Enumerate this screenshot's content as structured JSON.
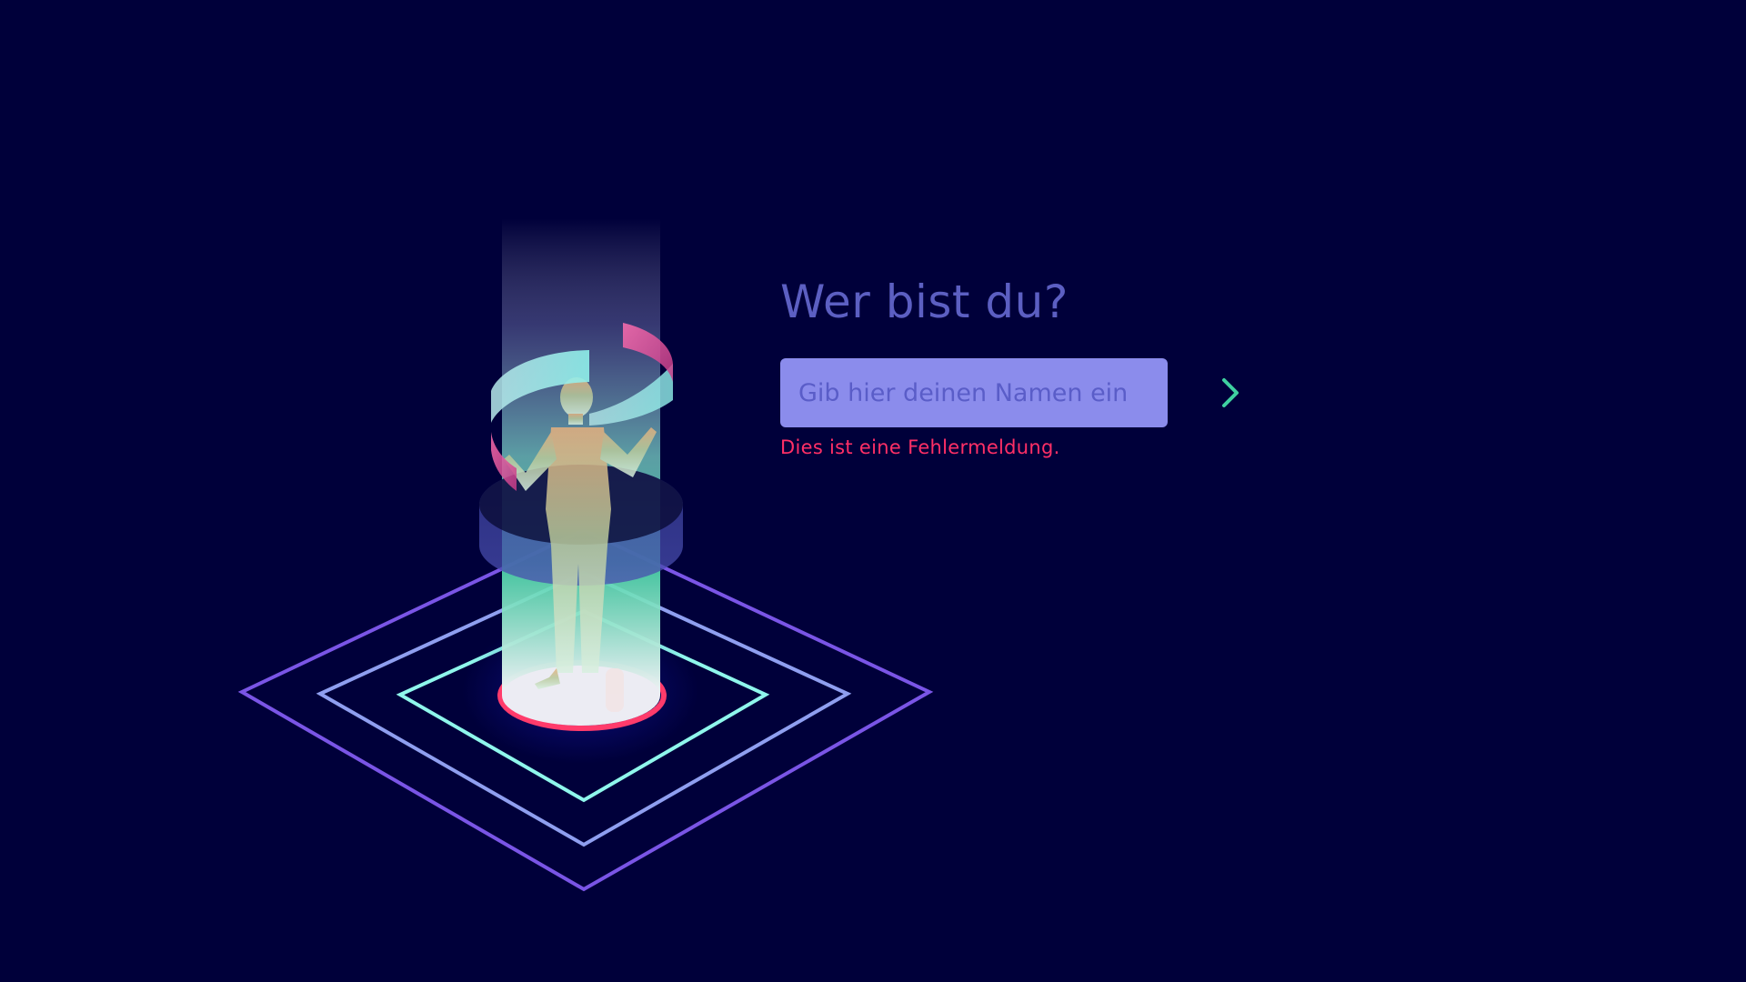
{
  "form": {
    "heading": "Wer bist du?",
    "input_value": "",
    "input_placeholder": "Gib hier deinen Namen ein",
    "submit_icon": "arrow-right-icon",
    "error_message": "Dies ist eine Fehlermeldung."
  },
  "colors": {
    "background": "#00003a",
    "heading": "#5c5fc2",
    "input_background": "#8b8cec",
    "error": "#ff2f66",
    "arrow": "#3fd0a0"
  }
}
